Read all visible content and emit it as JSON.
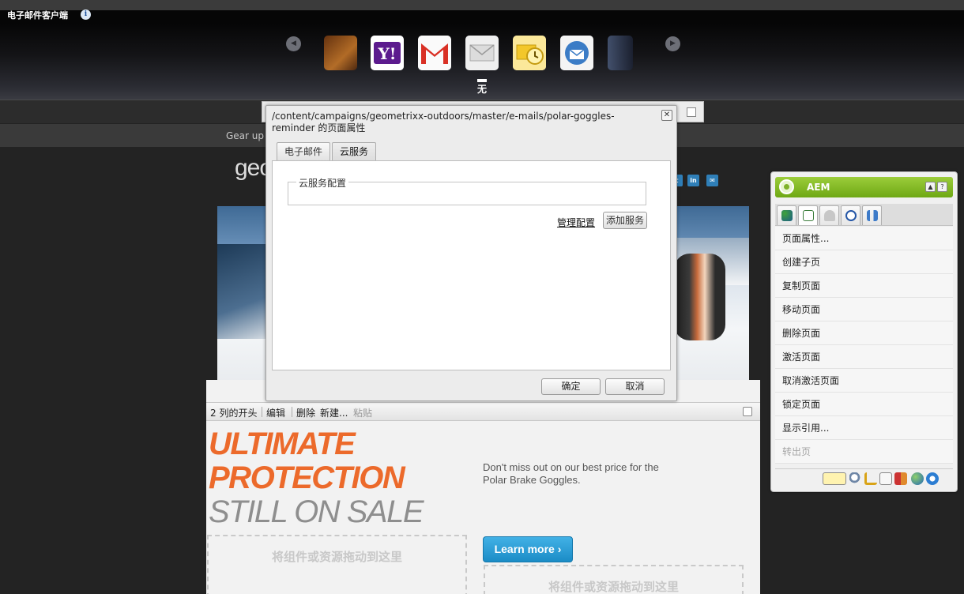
{
  "email_client": {
    "title": "电子邮件客户端",
    "selected_label": "无",
    "icons": [
      "firefox-icon",
      "yahoo-mail-icon",
      "gmail-icon",
      "generic-mail-icon",
      "outlook-icon",
      "thunderbird-icon",
      "apple-mail-icon"
    ]
  },
  "page": {
    "preheader_text": "Gear up w",
    "logo_text": "geo",
    "edit_bar": {
      "label": "2 列的开头",
      "edit": "编辑",
      "delete": "删除",
      "new": "新建...",
      "paste": "粘贴"
    },
    "headline_1": "ULTIMATE",
    "headline_2": "PROTECTION",
    "headline_3": "STILL ON SALE",
    "promo_text": "Don't miss out on our best price for the Polar Brake Goggles.",
    "learn_more": "Learn more ›",
    "dropzone_text": "将组件或资源拖动到这里"
  },
  "dialog": {
    "title": "/content/campaigns/geometrixx-outdoors/master/e-mails/polar-goggles-reminder 的页面属性",
    "tabs": [
      "电子邮件",
      "云服务"
    ],
    "active_tab": "云服务",
    "fieldset_legend": "云服务配置",
    "manage_config": "管理配置",
    "add_service": "添加服务",
    "ok": "确定",
    "cancel": "取消"
  },
  "sidekick": {
    "title": "AEM",
    "items": [
      "页面属性...",
      "创建子页",
      "复制页面",
      "移动页面",
      "删除页面",
      "激活页面",
      "取消激活页面",
      "锁定页面",
      "显示引用...",
      "转出页"
    ],
    "disabled_items": [
      "转出页"
    ]
  },
  "colors": {
    "accent_orange": "#ec6a2b",
    "sidekick_green": "#82bb25",
    "learn_more_blue": "#1b8cc6"
  }
}
